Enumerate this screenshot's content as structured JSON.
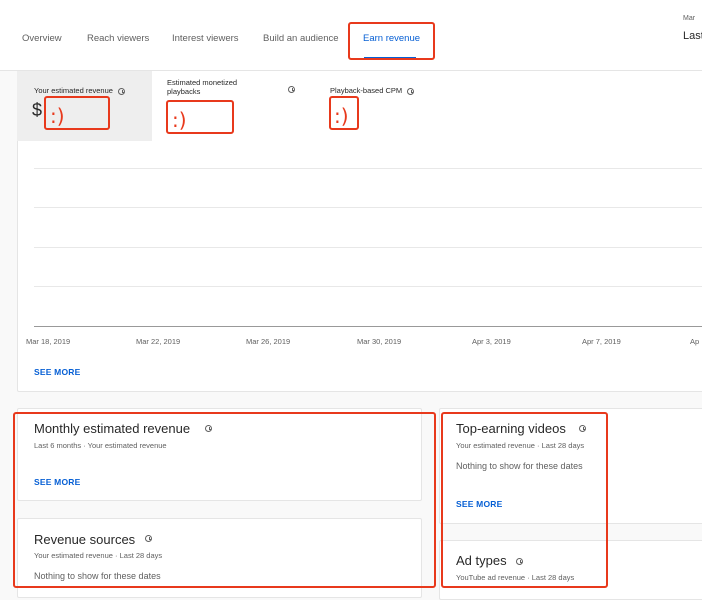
{
  "tabs": [
    {
      "label": "Overview"
    },
    {
      "label": "Reach viewers"
    },
    {
      "label": "Interest viewers"
    },
    {
      "label": "Build an audience"
    },
    {
      "label": "Earn revenue",
      "active": true
    }
  ],
  "date_range": {
    "top": "Mar",
    "bottom": "Last"
  },
  "metrics": [
    {
      "label": "Your estimated revenue",
      "prefix": "$",
      "value": ":)"
    },
    {
      "label_line1": "Estimated monetized",
      "label_line2": "playbacks",
      "value": ":)"
    },
    {
      "label": "Playback-based CPM",
      "value": ":)"
    }
  ],
  "chart_data": {
    "type": "line",
    "x": [
      "Mar 18, 2019",
      "Mar 22, 2019",
      "Mar 26, 2019",
      "Mar 30, 2019",
      "Apr 3, 2019",
      "Apr 7, 2019",
      "Ap"
    ],
    "series": [],
    "grid": true
  },
  "overview_see_more": "SEE MORE",
  "cards": {
    "monthly": {
      "title": "Monthly estimated revenue",
      "subtitle": "Last 6 months · Your estimated revenue",
      "see_more": "SEE MORE"
    },
    "revenue_sources": {
      "title": "Revenue sources",
      "subtitle": "Your estimated revenue · Last 28 days",
      "empty": "Nothing to show for these dates"
    },
    "top_videos": {
      "title": "Top-earning videos",
      "subtitle": "Your estimated revenue · Last 28 days",
      "empty": "Nothing to show for these dates",
      "see_more": "SEE MORE"
    },
    "ad_types": {
      "title": "Ad types",
      "subtitle": "YouTube ad revenue · Last 28 days"
    }
  },
  "colors": {
    "accent": "#065fd4",
    "highlight": "#e8391c"
  }
}
